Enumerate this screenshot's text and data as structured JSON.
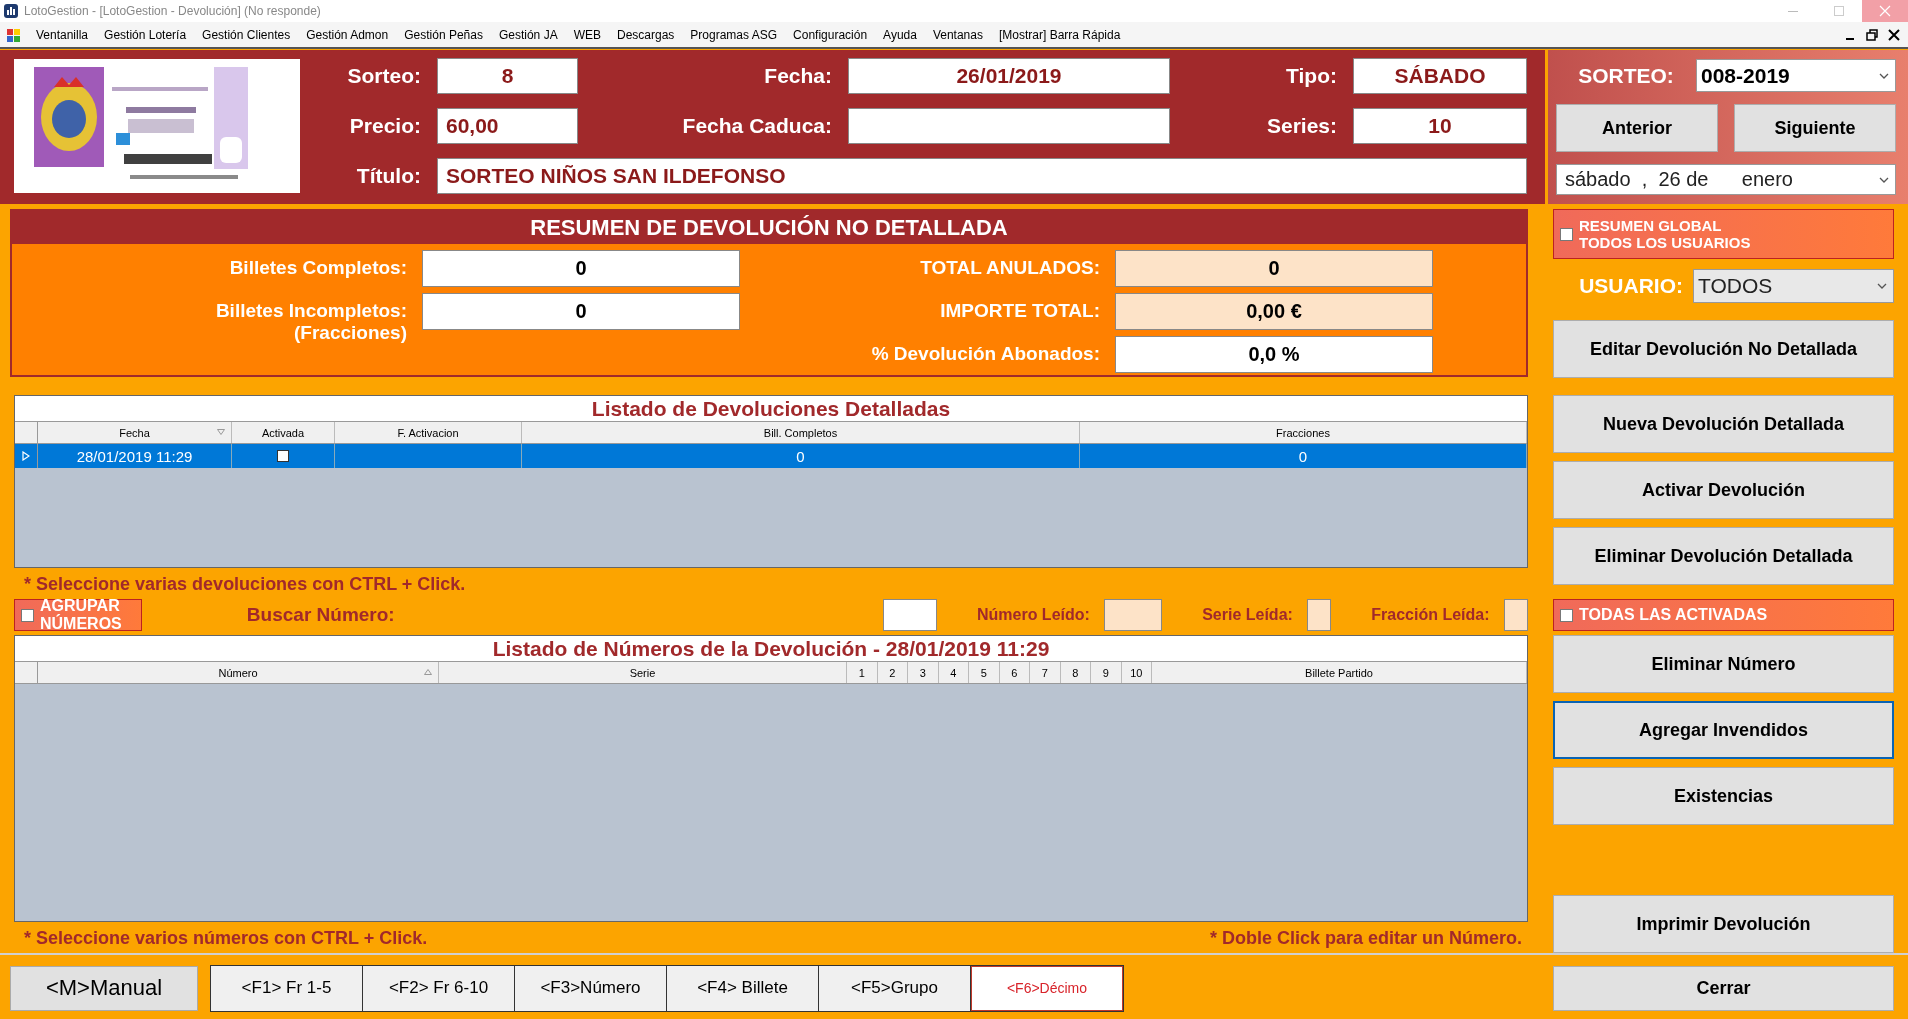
{
  "window": {
    "title": "LotoGestion - [LotoGestion - Devolución] (No responde)"
  },
  "menu": [
    "Ventanilla",
    "Gestión Lotería",
    "Gestión Clientes",
    "Gestión Admon",
    "Gestión Peñas",
    "Gestión JA",
    "WEB",
    "Descargas",
    "Programas ASG",
    "Configuración",
    "Ayuda",
    "Ventanas",
    "[Mostrar] Barra Rápida"
  ],
  "draw": {
    "sorteo": {
      "label": "Sorteo:",
      "value": "8"
    },
    "fecha": {
      "label": "Fecha:",
      "value": "26/01/2019"
    },
    "tipo": {
      "label": "Tipo:",
      "value": "SÁBADO"
    },
    "precio": {
      "label": "Precio:",
      "value": "60,00"
    },
    "caduca": {
      "label": "Fecha Caduca:"
    },
    "series": {
      "label": "Series:",
      "value": "10"
    },
    "titulo": {
      "label": "Título:",
      "value": "SORTEO NIÑOS SAN ILDEFONSO"
    }
  },
  "selector": {
    "label": "SORTEO:",
    "value": "008-2019",
    "buttons": [
      "Anterior",
      "Siguiente"
    ],
    "date": "sábado  ,  26 de      enero"
  },
  "summary": {
    "title": "RESUMEN DE DEVOLUCIÓN NO DETALLADA",
    "left": [
      {
        "label": "Billetes Completos:",
        "value": "0"
      },
      {
        "label": "Billetes Incompletos:",
        "sublabel": "(Fracciones)",
        "value": "0"
      }
    ],
    "right": [
      {
        "label": "TOTAL ANULADOS:",
        "value": "0",
        "readonly": true
      },
      {
        "label": "IMPORTE TOTAL:",
        "value": "0,00 €",
        "readonly": true
      },
      {
        "label": "% Devolución Abonados:",
        "value": "0,0 %",
        "readonly": false
      }
    ]
  },
  "global": {
    "lines": [
      "RESUMEN GLOBAL",
      "TODOS LOS USUARIOS"
    ],
    "checked": false
  },
  "user": {
    "label": "USUARIO:",
    "value": "TODOS"
  },
  "edit_button": "Editar Devolución No Detallada",
  "returns_table": {
    "title": "Listado de Devoluciones Detalladas",
    "columns": [
      "Fecha",
      "Activada",
      "F. Activacion",
      "Bill. Completos",
      "Fracciones"
    ],
    "rows": [
      {
        "fecha": "28/01/2019 11:29",
        "activada": false,
        "bill_completos": "0",
        "fracciones": "0",
        "selected": true
      }
    ]
  },
  "returns_note": "* Seleccione varias devoluciones con CTRL + Click.",
  "returns_buttons": [
    "Nueva Devolución Detallada",
    "Activar Devolución",
    "Eliminar Devolución Detallada"
  ],
  "group": {
    "label": "AGRUPAR NÚMEROS",
    "checked": false
  },
  "search": {
    "label": "Buscar Número:"
  },
  "read_fields": [
    {
      "label": "Número Leído:"
    },
    {
      "label": "Serie Leída:"
    },
    {
      "label": "Fracción Leída:"
    }
  ],
  "all_activated": {
    "label": "TODAS LAS ACTIVADAS",
    "checked": false
  },
  "numbers_table": {
    "title": "Listado de Números de la Devolución - 28/01/2019 11:29",
    "columns": [
      "Número",
      "Serie",
      "1",
      "2",
      "3",
      "4",
      "5",
      "6",
      "7",
      "8",
      "9",
      "10",
      "Billete Partido"
    ]
  },
  "numbers_notes": [
    "* Seleccione varios números con CTRL + Click.",
    "* Doble Click para editar un Número."
  ],
  "number_buttons": [
    {
      "label": "Eliminar Número",
      "focused": false
    },
    {
      "label": "Agregar Invendidos",
      "focused": true
    },
    {
      "label": "Existencias",
      "focused": false
    }
  ],
  "print_button": "Imprimir Devolución",
  "manual_button": "<M>Manual",
  "keys": [
    {
      "label": "<F1> Fr 1-5",
      "selected": false
    },
    {
      "label": "<F2> Fr 6-10",
      "selected": false
    },
    {
      "label": "<F3>Número",
      "selected": false
    },
    {
      "label": "<F4> Billete",
      "selected": false
    },
    {
      "label": "<F5>Grupo",
      "selected": false
    },
    {
      "label": "<F6>Décimo",
      "selected": true
    }
  ],
  "close_button": "Cerrar"
}
